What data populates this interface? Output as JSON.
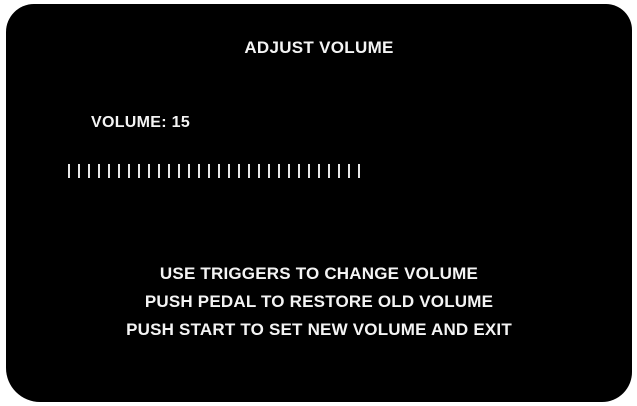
{
  "screen": {
    "title": "ADJUST VOLUME",
    "volume_label": "VOLUME:",
    "volume_value": "15",
    "volume_bar": {
      "tick_count": 30,
      "color": "#e8e8e8"
    },
    "instructions": [
      "USE TRIGGERS TO CHANGE VOLUME",
      "PUSH PEDAL TO RESTORE OLD VOLUME",
      "PUSH START TO SET NEW VOLUME AND EXIT"
    ],
    "colors": {
      "background": "#000000",
      "text": "#f4f4f4"
    }
  }
}
